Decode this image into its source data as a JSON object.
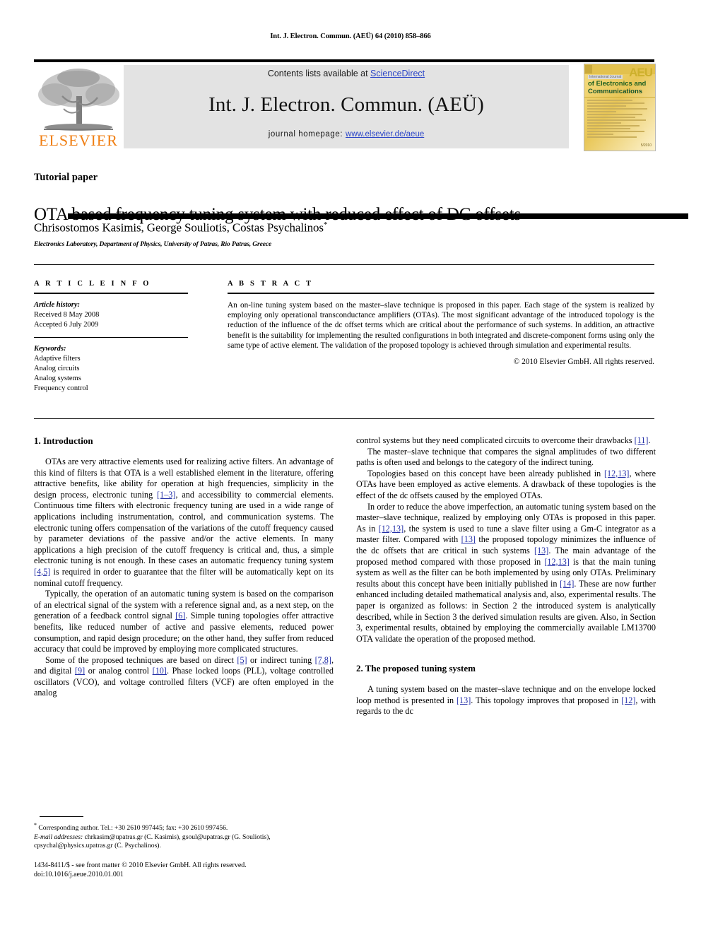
{
  "running_head": "Int. J. Electron. Commun. (AEÜ) 64 (2010) 858–866",
  "masthead": {
    "contents_prefix": "Contents lists available at ",
    "sciencedirect_link": "ScienceDirect",
    "journal_title": "Int. J. Electron. Commun. (AEÜ)",
    "homepage_prefix": "journal homepage: ",
    "homepage_link": "www.elsevier.de/aeue",
    "publisher_logo": "elsevier-tree-logo",
    "publisher_name": "ELSEVIER",
    "link_color": "#2c46c8",
    "panel_color": "#e3e3e3",
    "cover": {
      "badge": "AEU",
      "overline": "International Journal",
      "line1": "of Electronics and",
      "line2": "Communications",
      "footer": "5/2010"
    }
  },
  "title_block": {
    "category": "Tutorial paper",
    "title": "OTA based frequency tuning system with reduced effect of DC offsets",
    "authors": "Chrisostomos Kasimis, George Souliotis, Costas Psychalinos",
    "corresponding_marker": "*",
    "affiliation": "Electronics Laboratory, Department of Physics, University of Patras, Rio Patras, Greece"
  },
  "article_info": {
    "heading": "A R T I C L E   I N F O",
    "history_label": "Article history:",
    "history": [
      "Received 8 May 2008",
      "Accepted 6 July 2009"
    ],
    "keywords_label": "Keywords:",
    "keywords": [
      "Adaptive filters",
      "Analog circuits",
      "Analog systems",
      "Frequency control"
    ]
  },
  "abstract": {
    "heading": "A B S T R A C T",
    "text": "An on-line tuning system based on the master–slave technique is proposed in this paper. Each stage of the system is realized by employing only operational transconductance amplifiers (OTAs). The most significant advantage of the introduced topology is the reduction of the influence of the dc offset terms which are critical about the performance of such systems. In addition, an attractive benefit is the suitability for implementing the resulted configurations in both integrated and discrete-component forms using only the same type of active element. The validation of the proposed topology is achieved through simulation and experimental results.",
    "copyright": "© 2010 Elsevier GmbH. All rights reserved."
  },
  "body": {
    "section1_heading": "1.  Introduction",
    "left_paragraphs": [
      {
        "parts": [
          {
            "t": "OTAs are very attractive elements used for realizing active filters. An advantage of this kind of filters is that OTA is a well established element in the literature, offering attractive benefits, like ability for operation at high frequencies, simplicity in the design process, electronic tuning "
          },
          {
            "t": "[1–3]",
            "ref": true
          },
          {
            "t": ", and accessibility to commercial elements. Continuous time filters with electronic frequency tuning are used in a wide range of applications including instrumentation, control, and communication systems. The electronic tuning offers compensation of the variations of the cutoff frequency caused by parameter deviations of the passive and/or the active elements. In many applications a high precision of the cutoff frequency is critical and, thus, a simple electronic tuning is not enough. In these cases an automatic frequency tuning system "
          },
          {
            "t": "[4,5]",
            "ref": true
          },
          {
            "t": " is required in order to guarantee that the filter will be automatically kept on its nominal cutoff frequency."
          }
        ]
      },
      {
        "parts": [
          {
            "t": "Typically, the operation of an automatic tuning system is based on the comparison of an electrical signal of the system with a reference signal and, as a next step, on the generation of a feedback control signal "
          },
          {
            "t": "[6]",
            "ref": true
          },
          {
            "t": ". Simple tuning topologies offer attractive benefits, like reduced number of active and passive elements, reduced power consumption, and rapid design procedure; on the other hand, they suffer from reduced accuracy that could be improved by employing more complicated structures."
          }
        ]
      },
      {
        "parts": [
          {
            "t": "Some of the proposed techniques are based on direct "
          },
          {
            "t": "[5]",
            "ref": true
          },
          {
            "t": " or indirect tuning "
          },
          {
            "t": "[7,8]",
            "ref": true
          },
          {
            "t": ", and digital "
          },
          {
            "t": "[9]",
            "ref": true
          },
          {
            "t": " or analog control "
          },
          {
            "t": "[10]",
            "ref": true
          },
          {
            "t": ". Phase locked loops (PLL), voltage controlled oscillators (VCO), and voltage controlled filters (VCF) are often employed in the analog"
          }
        ]
      }
    ],
    "right_paragraphs": [
      {
        "indent": false,
        "parts": [
          {
            "t": "control systems but they need complicated circuits to overcome their drawbacks "
          },
          {
            "t": "[11]",
            "ref": true
          },
          {
            "t": "."
          }
        ]
      },
      {
        "indent": true,
        "parts": [
          {
            "t": "The master–slave technique that compares the signal amplitudes of two different paths is often used and belongs to the category of the indirect tuning."
          }
        ]
      },
      {
        "indent": true,
        "parts": [
          {
            "t": "Topologies based on this concept have been already published in "
          },
          {
            "t": "[12,13]",
            "ref": true
          },
          {
            "t": ", where OTAs have been employed as active elements. A drawback of these topologies is the effect of the dc offsets caused by the employed OTAs."
          }
        ]
      },
      {
        "indent": true,
        "parts": [
          {
            "t": "In order to reduce the above imperfection, an automatic tuning system based on the master–slave technique, realized by employing only OTAs is proposed in this paper. As in "
          },
          {
            "t": "[12,13]",
            "ref": true
          },
          {
            "t": ", the system is used to tune a slave filter using a Gm-C integrator as a master filter. Compared with "
          },
          {
            "t": "[13]",
            "ref": true
          },
          {
            "t": " the proposed topology minimizes the influence of the dc offsets that are critical in such systems "
          },
          {
            "t": "[13]",
            "ref": true
          },
          {
            "t": ". The main advantage of the proposed method compared with those proposed in "
          },
          {
            "t": "[12,13]",
            "ref": true
          },
          {
            "t": " is that the main tuning system as well as the filter can be both implemented by using only OTAs. Preliminary results about this concept have been initially published in "
          },
          {
            "t": "[14]",
            "ref": true
          },
          {
            "t": ". These are now further enhanced including detailed mathematical analysis and, also, experimental results. The paper is organized as follows: in Section 2 the introduced system is analytically described, while in Section 3 the derived simulation results are given. Also, in Section 3, experimental results, obtained by employing the commercially available LM13700 OTA validate the operation of the proposed method."
          }
        ]
      }
    ],
    "section2_heading": "2.  The proposed tuning system",
    "section2_paragraphs": [
      {
        "indent": true,
        "parts": [
          {
            "t": "A tuning system based on the master–slave technique and on the envelope locked loop method is presented in "
          },
          {
            "t": "[13]",
            "ref": true
          },
          {
            "t": ". This topology improves that proposed in "
          },
          {
            "t": "[12]",
            "ref": true
          },
          {
            "t": ", with regards to the dc"
          }
        ]
      }
    ]
  },
  "footnotes": {
    "corresponding": "Corresponding author. Tel.: +30 2610 997445; fax: +30 2610 997456.",
    "email_label": "E-mail addresses:",
    "emails": "chrkasim@upatras.gr (C. Kasimis), gsoul@upatras.gr (G. Souliotis), cpsychal@physics.upatras.gr (C. Psychalinos).",
    "imprint_line1": "1434-8411/$ - see front matter © 2010 Elsevier GmbH. All rights reserved.",
    "imprint_line2": "doi:10.1016/j.aeue.2010.01.001"
  }
}
